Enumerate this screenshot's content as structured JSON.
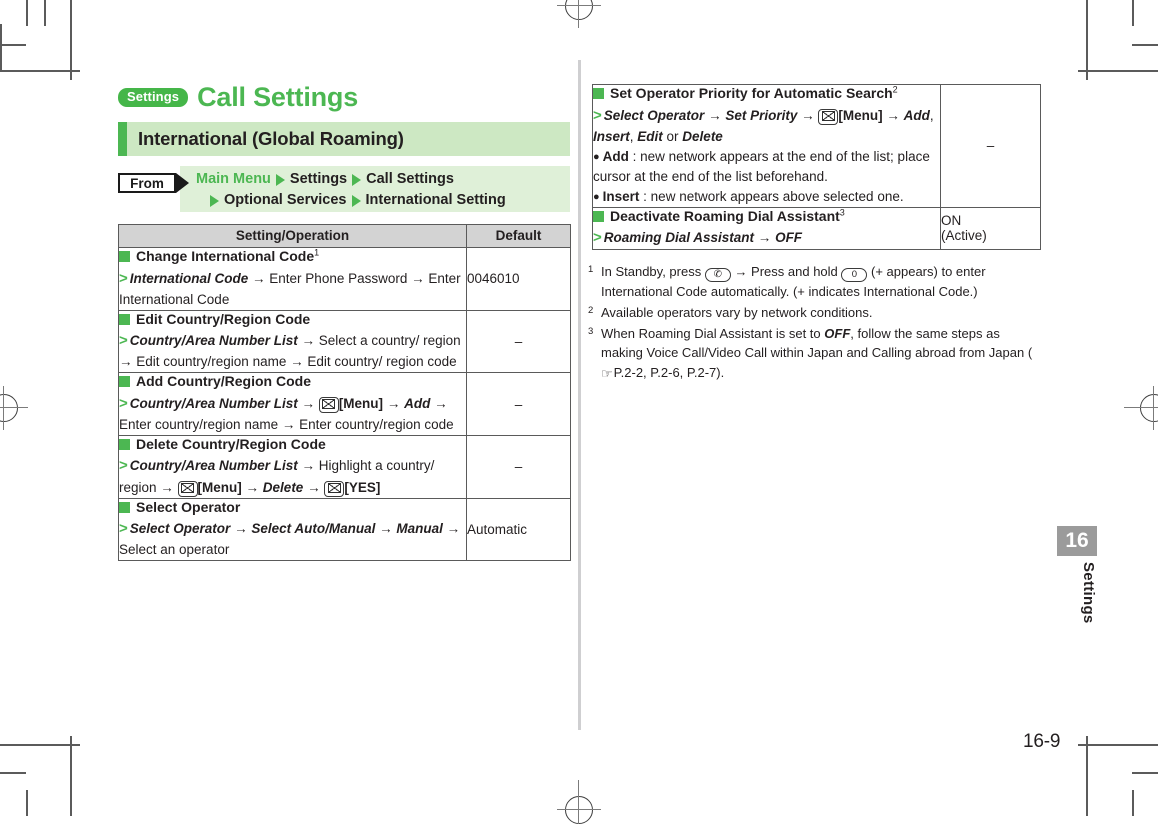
{
  "header": {
    "badge": "Settings",
    "chapter_title": "Call Settings",
    "section_title": "International (Global Roaming)",
    "accent_green": "#4cb752",
    "section_bg": "#cde8c3",
    "breadcrumb_bg": "#dff0d8"
  },
  "from": {
    "label": "From",
    "row1": [
      "Main Menu",
      "Settings",
      "Call Settings"
    ],
    "row2": [
      "Optional Services",
      "International Setting"
    ]
  },
  "table_left": {
    "columns": [
      "Setting/Operation",
      "Default"
    ],
    "rows": [
      {
        "title": "Change International Code",
        "title_sup": "1",
        "steps": [
          {
            "prefix": ">",
            "parts": [
              {
                "t": "International Code",
                "s": "bi"
              },
              {
                "t": " → Enter Phone Password →",
                "s": "n"
              },
              {
                "t": " Enter International Code",
                "s": "n"
              }
            ]
          }
        ],
        "default": "0046010"
      },
      {
        "title": "Edit Country/Region Code",
        "title_sup": "",
        "steps": [
          {
            "prefix": ">",
            "parts": [
              {
                "t": "Country/Area Number List",
                "s": "bi"
              },
              {
                "t": " → Select a country/ region → Edit country/region name → Edit country/ region code",
                "s": "n"
              }
            ]
          }
        ],
        "default": "–"
      },
      {
        "title": "Add Country/Region Code",
        "title_sup": "",
        "steps": [
          {
            "prefix": ">",
            "parts": [
              {
                "t": "Country/Area Number List",
                "s": "bi"
              },
              {
                "t": " → ",
                "s": "n"
              },
              {
                "t": "envelope-key",
                "s": "icon-env"
              },
              {
                "t": "[Menu]",
                "s": "b"
              },
              {
                "t": " → ",
                "s": "n"
              },
              {
                "t": "Add",
                "s": "bi"
              },
              {
                "t": " → Enter country/region name → Enter country/region code",
                "s": "n"
              }
            ]
          }
        ],
        "default": "–"
      },
      {
        "title": "Delete Country/Region Code",
        "title_sup": "",
        "steps": [
          {
            "prefix": ">",
            "parts": [
              {
                "t": "Country/Area Number List",
                "s": "bi"
              },
              {
                "t": " → Highlight a country/ region → ",
                "s": "n"
              },
              {
                "t": "envelope-key",
                "s": "icon-env"
              },
              {
                "t": "[Menu]",
                "s": "b"
              },
              {
                "t": " → ",
                "s": "n"
              },
              {
                "t": "Delete",
                "s": "bi"
              },
              {
                "t": " → ",
                "s": "n"
              },
              {
                "t": "envelope-key",
                "s": "icon-env"
              },
              {
                "t": "[YES]",
                "s": "b"
              }
            ]
          }
        ],
        "default": "–"
      },
      {
        "title": "Select Operator",
        "title_sup": "",
        "steps": [
          {
            "prefix": ">",
            "parts": [
              {
                "t": "Select Operator",
                "s": "bi"
              },
              {
                "t": " → ",
                "s": "n"
              },
              {
                "t": "Select Auto/Manual",
                "s": "bi"
              },
              {
                "t": " → ",
                "s": "n"
              },
              {
                "t": "Manual",
                "s": "bi"
              },
              {
                "t": " → Select an operator",
                "s": "n"
              }
            ]
          }
        ],
        "default": "Automatic"
      }
    ]
  },
  "table_right": {
    "rows": [
      {
        "title": "Set Operator Priority for Automatic Search",
        "title_sup": "2",
        "steps": [
          {
            "prefix": ">",
            "parts": [
              {
                "t": "Select Operator",
                "s": "bi"
              },
              {
                "t": " → ",
                "s": "n"
              },
              {
                "t": "Set Priority",
                "s": "bi"
              },
              {
                "t": " → ",
                "s": "n"
              },
              {
                "t": "envelope-key",
                "s": "icon-env"
              },
              {
                "t": "[Menu]",
                "s": "b"
              },
              {
                "t": " → ",
                "s": "n"
              },
              {
                "t": "Add",
                "s": "bi"
              },
              {
                "t": ", ",
                "s": "n"
              },
              {
                "t": "Insert",
                "s": "bi"
              },
              {
                "t": ", ",
                "s": "n"
              },
              {
                "t": "Edit",
                "s": "bi"
              },
              {
                "t": " or ",
                "s": "n"
              },
              {
                "t": "Delete",
                "s": "bi"
              }
            ]
          }
        ],
        "bullets": [
          [
            {
              "t": "Add",
              "s": "bi"
            },
            {
              "t": " : new network appears at the end of the list; place cursor at the end of the list beforehand.",
              "s": "n"
            }
          ],
          [
            {
              "t": "Insert",
              "s": "bi"
            },
            {
              "t": " : new network appears above selected one.",
              "s": "n"
            }
          ]
        ],
        "default": "–"
      },
      {
        "title": "Deactivate Roaming Dial Assistant",
        "title_sup": "3",
        "steps": [
          {
            "prefix": ">",
            "parts": [
              {
                "t": "Roaming Dial Assistant",
                "s": "bi"
              },
              {
                "t": " → ",
                "s": "n"
              },
              {
                "t": "OFF",
                "s": "bi"
              }
            ]
          }
        ],
        "bullets": [],
        "default": "ON\n(Active)"
      }
    ]
  },
  "footnotes": [
    {
      "num": "1",
      "parts": [
        {
          "t": "In Standby, press ",
          "s": "n"
        },
        {
          "t": "phone-key",
          "s": "icon-phone"
        },
        {
          "t": " → Press and hold ",
          "s": "n"
        },
        {
          "t": "zero-key",
          "s": "icon-zero"
        },
        {
          "t": " (+ appears) to enter International Code automatically. (+ indicates International Code.)",
          "s": "n"
        }
      ]
    },
    {
      "num": "2",
      "parts": [
        {
          "t": "Available operators vary by network conditions.",
          "s": "n"
        }
      ]
    },
    {
      "num": "3",
      "parts": [
        {
          "t": "When Roaming Dial Assistant is set to ",
          "s": "n"
        },
        {
          "t": "OFF",
          "s": "bi"
        },
        {
          "t": ", follow the same steps as making Voice Call/Video Call within Japan and Calling abroad from Japan (",
          "s": "n"
        },
        {
          "t": "page-ref",
          "s": "icon-hand"
        },
        {
          "t": "P.2-2, P.2-6, P.2-7).",
          "s": "n"
        }
      ]
    }
  ],
  "side_tab": {
    "number": "16",
    "label": "Settings",
    "tab_bg": "#9b9b9b"
  },
  "folio": "16-9"
}
